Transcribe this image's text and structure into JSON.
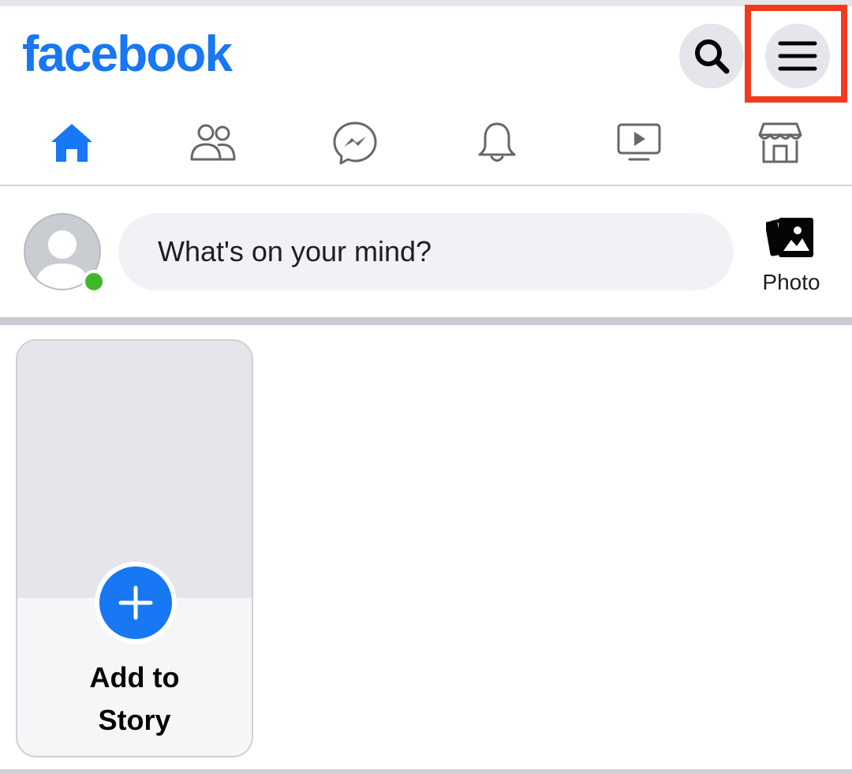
{
  "header": {
    "logo": "facebook",
    "brand_color": "#1877f2",
    "search_icon": "search-icon",
    "menu_icon": "hamburger-menu-icon",
    "highlight_color": "#f03b1f"
  },
  "nav": {
    "items": [
      {
        "icon": "home-icon",
        "active": true
      },
      {
        "icon": "friends-icon",
        "active": false
      },
      {
        "icon": "messenger-icon",
        "active": false
      },
      {
        "icon": "bell-icon",
        "active": false
      },
      {
        "icon": "video-icon",
        "active": false
      },
      {
        "icon": "marketplace-icon",
        "active": false
      }
    ]
  },
  "composer": {
    "placeholder": "What's on your mind?",
    "photo_label": "Photo",
    "online_color": "#42b72a"
  },
  "story": {
    "add_label_line1": "Add to",
    "add_label_line2": "Story"
  }
}
